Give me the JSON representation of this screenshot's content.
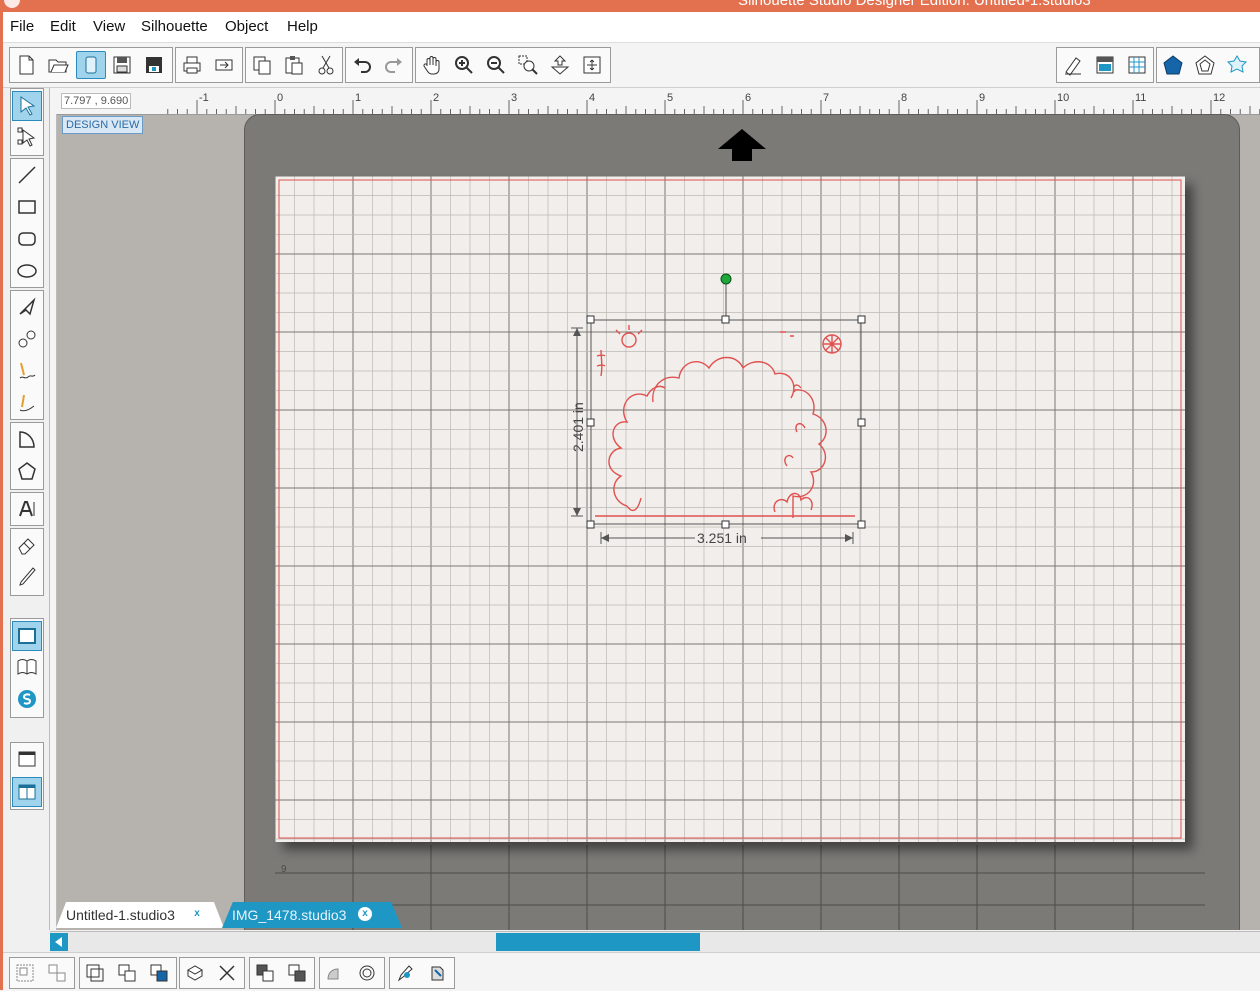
{
  "window": {
    "title": "Silhouette Studio Designer Edition: Untitled-1.studio3"
  },
  "menu": [
    "File",
    "Edit",
    "View",
    "Silhouette",
    "Object",
    "Help"
  ],
  "ruler": {
    "coordinates": "7.797 , 9.690",
    "labels": [
      "-1",
      "0",
      "1",
      "2",
      "3",
      "4",
      "5",
      "6",
      "7",
      "8",
      "9",
      "10",
      "11",
      "12"
    ],
    "vertical_label": "9"
  },
  "view_mode": "DESIGN VIEW",
  "selection": {
    "width_label": "3.251 in",
    "height_label": "2.401 in"
  },
  "tabs": [
    {
      "label": "Untitled-1.studio3",
      "close": "x",
      "active": false
    },
    {
      "label": "IMG_1478.studio3",
      "close": "x",
      "active": true
    }
  ],
  "colors": {
    "accent": "#1f97c5",
    "title_bar": "#e3704f",
    "cut_line": "#e0514f",
    "mat": "#7b7a77",
    "grid_bg": "#f1eeeb"
  },
  "toolbar_icons": [
    "new-document-icon",
    "open-folder-icon",
    "page-icon",
    "save-icon",
    "save-to-library-icon",
    "print-icon",
    "send-to-cutter-icon",
    "copy-icon",
    "paste-icon",
    "cut-icon",
    "undo-icon",
    "redo-icon",
    "pan-hand-icon",
    "zoom-in-icon",
    "zoom-out-icon",
    "zoom-box-icon",
    "zoom-fit-icon",
    "zoom-page-icon",
    "line-style-icon",
    "fill-panel-icon",
    "pattern-fill-icon",
    "shape-library-icon",
    "offset-icon",
    "replicate-icon"
  ],
  "left_tools": [
    "select-arrow-icon",
    "point-edit-icon",
    "line-tool-icon",
    "rectangle-tool-icon",
    "rounded-rectangle-tool-icon",
    "ellipse-tool-icon",
    "polygon-tool-icon",
    "curve-tool-icon",
    "freehand-tool-icon",
    "smooth-freehand-tool-icon",
    "arc-tool-icon",
    "regular-polygon-tool-icon",
    "text-tool-icon",
    "eraser-tool-icon",
    "knife-tool-icon",
    "page-setup-icon",
    "library-icon",
    "silhouette-store-icon",
    "window-toggle-icon",
    "split-view-icon"
  ]
}
